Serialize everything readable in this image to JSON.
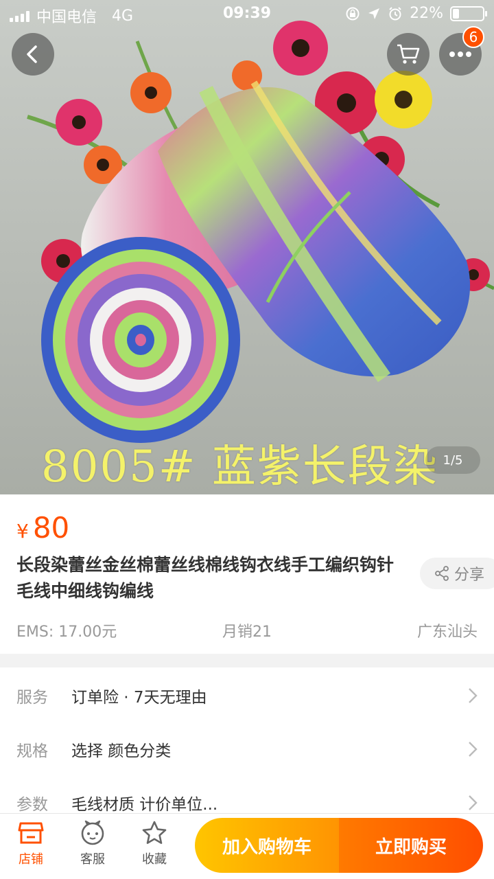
{
  "status_bar": {
    "carrier": "中国电信",
    "network": "4G",
    "time": "09:39",
    "battery_percent_text": "22%",
    "battery_level": 0.22
  },
  "gallery": {
    "caption": "8005#  蓝紫长段染",
    "page_indicator": "1/5"
  },
  "header": {
    "more_badge": "6",
    "icons": [
      "back-icon",
      "cart-icon",
      "more-icon"
    ]
  },
  "product": {
    "currency": "¥",
    "price": "80",
    "title": "长段染蕾丝金丝棉蕾丝线棉线钩衣线手工编织钩针毛线中细线钩编线",
    "share_label": "分享",
    "shipping": "EMS: 17.00元",
    "monthly_sales": "月销21",
    "location": "广东汕头"
  },
  "services": [
    {
      "label": "服务",
      "value": "订单险 · 7天无理由"
    },
    {
      "label": "规格",
      "value": "选择  颜色分类"
    },
    {
      "label": "参数",
      "value": "毛线材质 计价单位..."
    }
  ],
  "bottom_bar": {
    "shop_label": "店铺",
    "service_label": "客服",
    "favorite_label": "收藏",
    "add_to_cart_label": "加入购物车",
    "buy_now_label": "立即购买"
  },
  "colors": {
    "accent": "#ff5000",
    "cart_button": "#ffa800",
    "buy_button": "#ff5a00"
  }
}
